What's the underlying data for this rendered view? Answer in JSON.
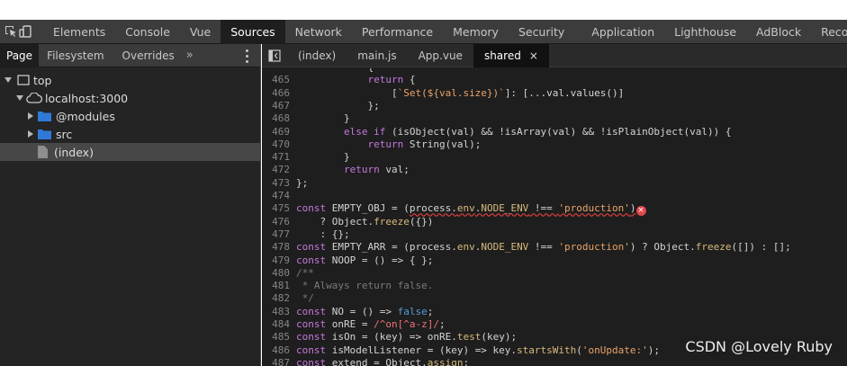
{
  "devtools": {
    "panel_tabs": [
      "Elements",
      "Console",
      "Vue",
      "Sources",
      "Network",
      "Performance",
      "Memory",
      "Security",
      "Application",
      "Lighthouse",
      "AdBlock",
      "Recorder"
    ],
    "active_panel": "Sources"
  },
  "sidebar": {
    "tabs": [
      "Page",
      "Filesystem",
      "Overrides"
    ],
    "more": "»",
    "tree": {
      "top": "top",
      "host": "localhost:3000",
      "modules": "@modules",
      "src": "src",
      "index": "(index)"
    }
  },
  "editor": {
    "tabs": [
      "(index)",
      "main.js",
      "App.vue",
      "shared"
    ],
    "active_tab": "shared",
    "close": "×",
    "lines": [
      {
        "n": "465",
        "t": "            return {"
      },
      {
        "n": "466",
        "t": "                [`Set(${val.size})`]: [...val.values()]"
      },
      {
        "n": "467",
        "t": "            };"
      },
      {
        "n": "468",
        "t": "        }"
      },
      {
        "n": "469",
        "t": "        else if (isObject(val) && !isArray(val) && !isPlainObject(val)) {"
      },
      {
        "n": "470",
        "t": "            return String(val);"
      },
      {
        "n": "471",
        "t": "        }"
      },
      {
        "n": "472",
        "t": "        return val;"
      },
      {
        "n": "473",
        "t": "};"
      },
      {
        "n": "474",
        "t": ""
      },
      {
        "n": "475",
        "t": "const EMPTY_OBJ = (process.env.NODE_ENV !== 'production')"
      },
      {
        "n": "476",
        "t": "    ? Object.freeze({})"
      },
      {
        "n": "477",
        "t": "    : {};"
      },
      {
        "n": "478",
        "t": "const EMPTY_ARR = (process.env.NODE_ENV !== 'production') ? Object.freeze([]) : [];"
      },
      {
        "n": "479",
        "t": "const NOOP = () => { };"
      },
      {
        "n": "480",
        "t": "/**"
      },
      {
        "n": "481",
        "t": " * Always return false."
      },
      {
        "n": "482",
        "t": " */"
      },
      {
        "n": "483",
        "t": "const NO = () => false;"
      },
      {
        "n": "484",
        "t": "const onRE = /^on[^a-z]/;"
      },
      {
        "n": "485",
        "t": "const isOn = (key) => onRE.test(key);"
      },
      {
        "n": "486",
        "t": "const isModelListener = (key) => key.startsWith('onUpdate:');"
      },
      {
        "n": "487",
        "t": "const extend = Object.assign;"
      }
    ],
    "error_mark": "×"
  },
  "watermark": "CSDN @Lovely Ruby"
}
